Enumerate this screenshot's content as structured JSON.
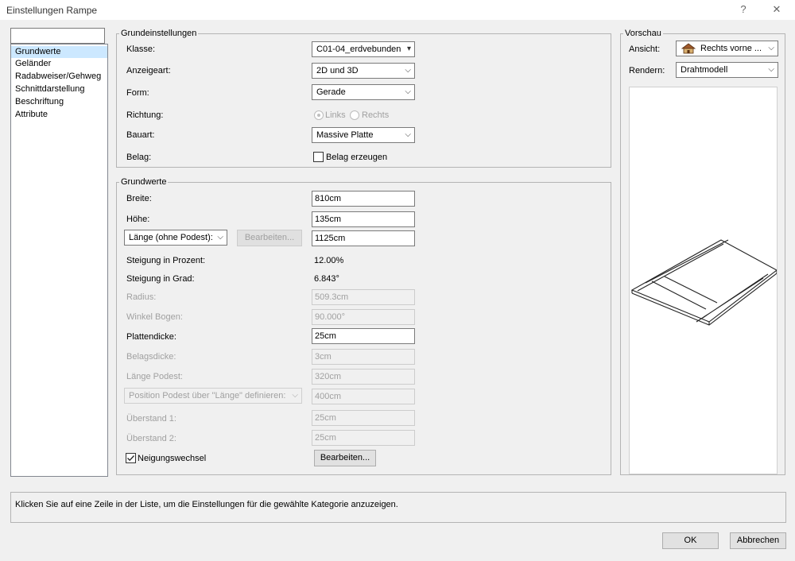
{
  "window": {
    "title": "Einstellungen Rampe",
    "help": "?",
    "close": "✕"
  },
  "nav": {
    "items": [
      "Grundwerte",
      "Geländer",
      "Radabweiser/Gehweg",
      "Schnittdarstellung",
      "Beschriftung",
      "Attribute"
    ],
    "selected": "Grundwerte"
  },
  "grundeinstellungen": {
    "legend": "Grundeinstellungen",
    "klasse_label": "Klasse:",
    "klasse_value": "C01-04_erdvebunden",
    "anzeigeart_label": "Anzeigeart:",
    "anzeigeart_value": "2D und 3D",
    "form_label": "Form:",
    "form_value": "Gerade",
    "richtung_label": "Richtung:",
    "richtung_links": "Links",
    "richtung_rechts": "Rechts",
    "bauart_label": "Bauart:",
    "bauart_value": "Massive Platte",
    "belag_label": "Belag:",
    "belag_check": "Belag erzeugen"
  },
  "grundwerte": {
    "legend": "Grundwerte",
    "breite_label": "Breite:",
    "breite_value": "810cm",
    "hoehe_label": "Höhe:",
    "hoehe_value": "135cm",
    "laenge_select": "Länge (ohne Podest):",
    "laenge_edit_button": "Bearbeiten...",
    "laenge_value": "1125cm",
    "steigung_prozent_label": "Steigung in Prozent:",
    "steigung_prozent_value": "12.00%",
    "steigung_grad_label": "Steigung in Grad:",
    "steigung_grad_value": "6.843°",
    "radius_label": "Radius:",
    "radius_value": "509.3cm",
    "winkel_label": "Winkel Bogen:",
    "winkel_value": "90.000°",
    "plattendicke_label": "Plattendicke:",
    "plattendicke_value": "25cm",
    "belagsdicke_label": "Belagsdicke:",
    "belagsdicke_value": "3cm",
    "laenge_podest_label": "Länge Podest:",
    "laenge_podest_value": "320cm",
    "position_podest_select": "Position Podest über \"Länge\" definieren:",
    "position_podest_value": "400cm",
    "ueberstand1_label": "Überstand 1:",
    "ueberstand1_value": "25cm",
    "ueberstand2_label": "Überstand 2:",
    "ueberstand2_value": "25cm",
    "neigungswechsel_label": "Neigungswechsel",
    "neigungswechsel_button": "Bearbeiten..."
  },
  "vorschau": {
    "legend": "Vorschau",
    "ansicht_label": "Ansicht:",
    "ansicht_value": "Rechts vorne ...",
    "rendern_label": "Rendern:",
    "rendern_value": "Drahtmodell"
  },
  "status": {
    "text": "Klicken Sie auf eine Zeile in der Liste, um die Einstellungen für die gewählte Kategorie anzuzeigen."
  },
  "buttons": {
    "ok": "OK",
    "cancel": "Abbrechen"
  }
}
